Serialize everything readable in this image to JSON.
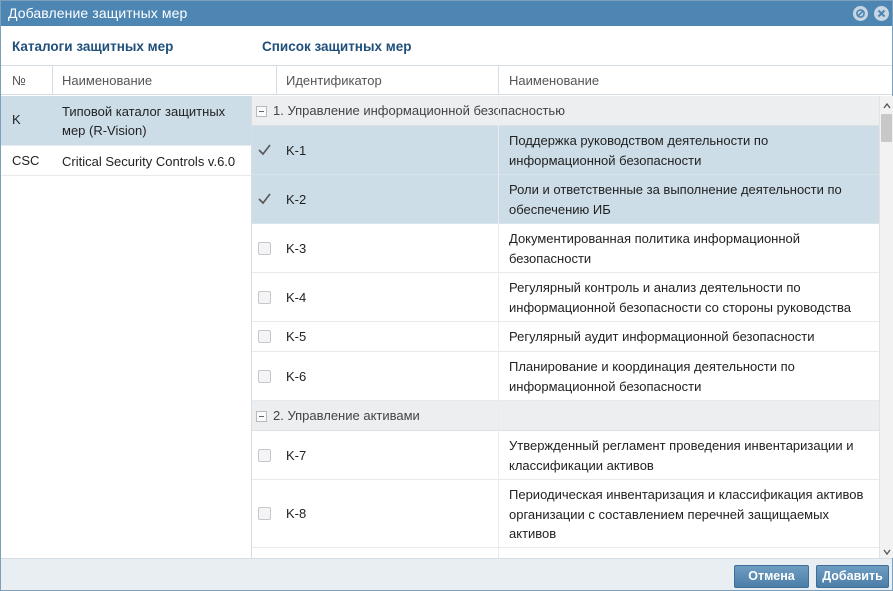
{
  "window": {
    "title": "Добавление защитных мер"
  },
  "catalogs": {
    "title": "Каталоги защитных мер",
    "headers": {
      "no": "№",
      "name": "Наименование"
    },
    "rows": [
      {
        "code": "K",
        "name": "Типовой каталог защитных мер (R-Vision)",
        "selected": true
      },
      {
        "code": "CSC",
        "name": "Critical Security Controls v.6.0",
        "selected": false
      }
    ]
  },
  "measures": {
    "title": "Список защитных мер",
    "headers": {
      "id": "Идентификатор",
      "name": "Наименование"
    },
    "groups": [
      {
        "title": "1. Управление информационной безопасностью",
        "rows": [
          {
            "id": "K-1",
            "name": "Поддержка руководством деятельности по информационной безопасности",
            "checked": true
          },
          {
            "id": "K-2",
            "name": "Роли и ответственные за выполнение деятельности по обеспечению ИБ",
            "checked": true
          },
          {
            "id": "K-3",
            "name": "Документированная политика информационной безопасности",
            "checked": false
          },
          {
            "id": "K-4",
            "name": "Регулярный контроль и анализ деятельности по информационной безопасности со стороны руководства",
            "checked": false
          },
          {
            "id": "K-5",
            "name": "Регулярный аудит информационной безопасности",
            "checked": false
          },
          {
            "id": "K-6",
            "name": "Планирование и координация деятельности по информационной безопасности",
            "checked": false
          }
        ]
      },
      {
        "title": "2. Управление активами",
        "rows": [
          {
            "id": "K-7",
            "name": "Утвержденный регламент проведения инвентаризации и классификации активов",
            "checked": false
          },
          {
            "id": "K-8",
            "name": "Периодическая инвентаризация и классификация активов организации с составлением перечней защищаемых активов",
            "checked": false
          }
        ]
      }
    ]
  },
  "footer": {
    "cancel_label": "Отмена",
    "add_label": "Добавить"
  },
  "colors": {
    "titlebar": "#4e86b3",
    "selected_row": "#ccdde8",
    "section_title": "#1f4f7a",
    "button": "#5b8db5"
  }
}
